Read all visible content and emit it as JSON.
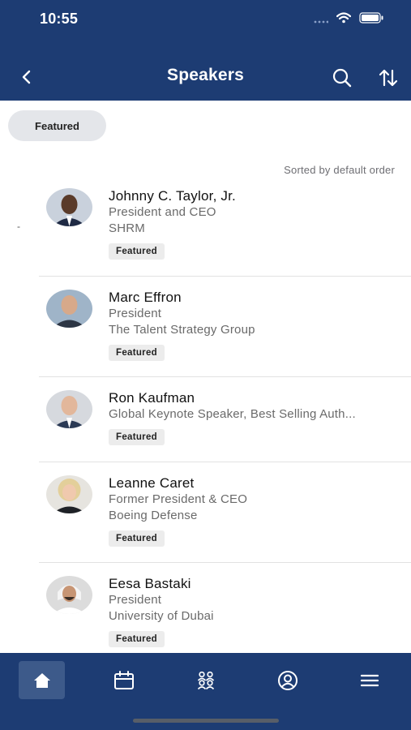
{
  "status_bar": {
    "time": "10:55",
    "icons": [
      "signal-icon",
      "wifi-icon",
      "battery-icon"
    ]
  },
  "header": {
    "title": "Speakers",
    "icons": [
      "back-chevron-icon",
      "search-icon",
      "sort-icon"
    ]
  },
  "filter": {
    "chip_label": "Featured"
  },
  "sort_label": "Sorted by default order",
  "left_marker": "-",
  "speakers": [
    {
      "name": "Johnny C. Taylor, Jr.",
      "lines": [
        "President and CEO",
        "SHRM"
      ],
      "badge": "Featured"
    },
    {
      "name": "Marc Effron",
      "lines": [
        "President",
        "The Talent Strategy Group"
      ],
      "badge": "Featured"
    },
    {
      "name": "Ron Kaufman",
      "lines": [
        "Global Keynote Speaker, Best Selling Auth..."
      ],
      "badge": "Featured"
    },
    {
      "name": "Leanne Caret",
      "lines": [
        "Former President & CEO",
        "Boeing Defense"
      ],
      "badge": "Featured"
    },
    {
      "name": "Eesa Bastaki",
      "lines": [
        "President",
        "University of Dubai"
      ],
      "badge": "Featured"
    }
  ],
  "tabbar": {
    "tabs": [
      "home-icon",
      "calendar-icon",
      "attendees-icon",
      "profile-icon",
      "menu-icon"
    ],
    "active_tab": "home-icon"
  },
  "colors": {
    "brand": "#1d3c73",
    "active_tab": "#3d5a8a",
    "chip": "#e4e6ea",
    "badge": "#ececec"
  }
}
